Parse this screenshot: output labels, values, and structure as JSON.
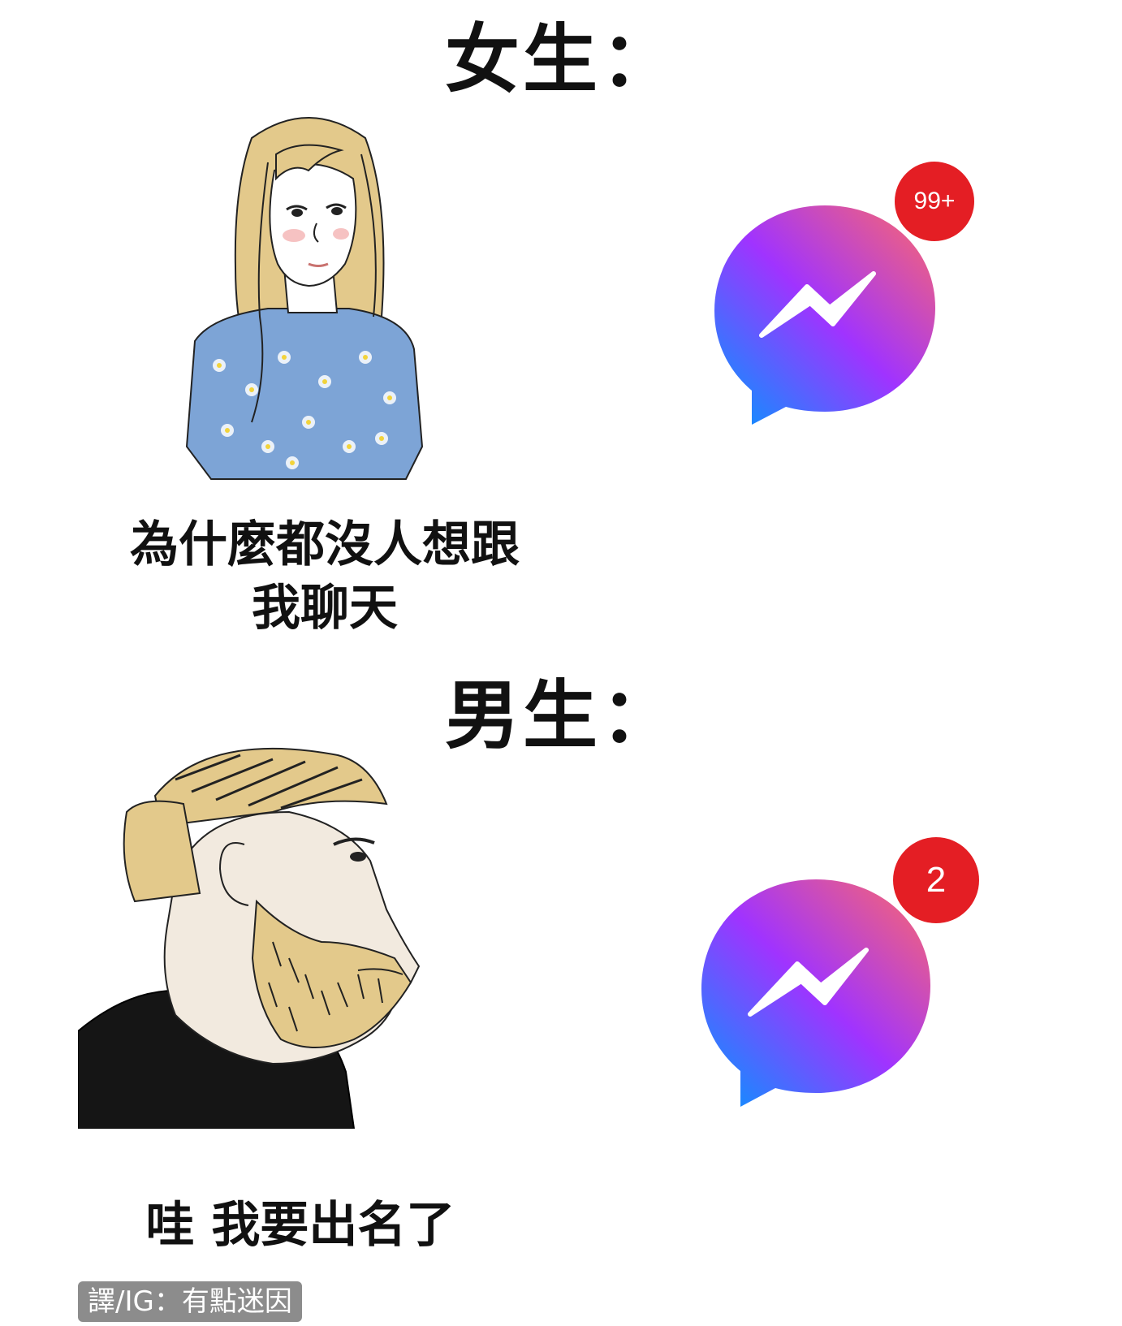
{
  "top_panel": {
    "heading": "女生：",
    "caption_line1": "為什麼都沒人想跟",
    "caption_line2": "我聊天",
    "badge_count": "99+"
  },
  "bottom_panel": {
    "heading": "男生：",
    "caption": "哇 我要出名了",
    "badge_count": "2"
  },
  "watermark": "譯/IG：有點迷因",
  "icons": {
    "app_icon": "messenger-icon",
    "badge_color": "#e41e24",
    "gradient_colors": [
      "#ff6a68",
      "#a033ff",
      "#0099ff"
    ]
  }
}
